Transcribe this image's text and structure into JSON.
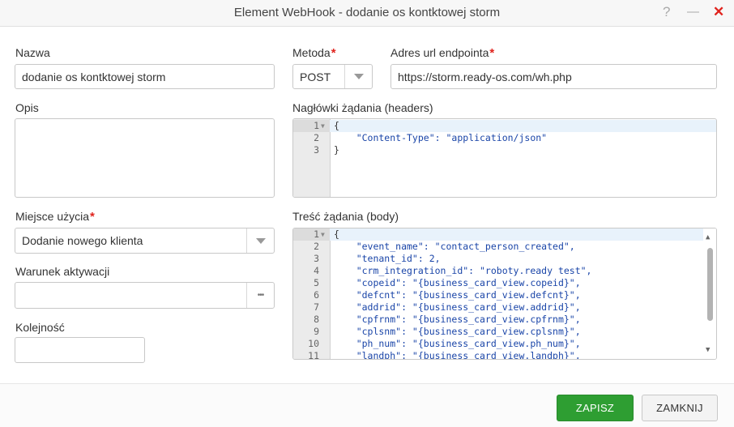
{
  "window": {
    "title": "Element WebHook - dodanie os kontktowej storm",
    "help_glyph": "?",
    "minimize_glyph": "—",
    "close_glyph": "✕",
    "close_color": "#e0231d"
  },
  "form": {
    "nazwa": {
      "label": "Nazwa",
      "value": "dodanie os kontktowej storm"
    },
    "metoda": {
      "label": "Metoda",
      "required": "*",
      "value": "POST"
    },
    "adres": {
      "label": "Adres url endpointa",
      "required": "*",
      "value": "https://storm.ready-os.com/wh.php"
    },
    "opis": {
      "label": "Opis",
      "value": ""
    },
    "naglowki": {
      "label": "Nagłówki żądania (headers)",
      "lines": [
        {
          "n": "1",
          "text": "{"
        },
        {
          "n": "2",
          "text": "    \"Content-Type\": \"application/json\""
        },
        {
          "n": "3",
          "text": "}"
        }
      ]
    },
    "miejsce": {
      "label": "Miejsce użycia",
      "required": "*",
      "value": "Dodanie nowego klienta"
    },
    "warunek": {
      "label": "Warunek aktywacji",
      "value": "",
      "button": "•••"
    },
    "kolejnosc": {
      "label": "Kolejność",
      "value": ""
    },
    "tresc": {
      "label": "Treść żądania (body)",
      "lines": [
        {
          "n": "1",
          "text": "{"
        },
        {
          "n": "2",
          "text": "    \"event_name\": \"contact_person_created\","
        },
        {
          "n": "3",
          "text": "    \"tenant_id\": 2,"
        },
        {
          "n": "4",
          "text": "    \"crm_integration_id\": \"roboty.ready test\","
        },
        {
          "n": "5",
          "text": "    \"copeid\": \"{business_card_view.copeid}\","
        },
        {
          "n": "6",
          "text": "    \"defcnt\": \"{business_card_view.defcnt}\","
        },
        {
          "n": "7",
          "text": "    \"addrid\": \"{business_card_view.addrid}\","
        },
        {
          "n": "8",
          "text": "    \"cpfrnm\": \"{business_card_view.cpfrnm}\","
        },
        {
          "n": "9",
          "text": "    \"cplsnm\": \"{business_card_view.cplsnm}\","
        },
        {
          "n": "10",
          "text": "    \"ph_num\": \"{business_card_view.ph_num}\","
        },
        {
          "n": "11",
          "text": "    \"landph\": \"{business_card_view.landph}\","
        }
      ]
    }
  },
  "footer": {
    "save_label": "ZAPISZ",
    "close_label": "ZAMKNIJ",
    "save_color": "#2e9e32"
  }
}
